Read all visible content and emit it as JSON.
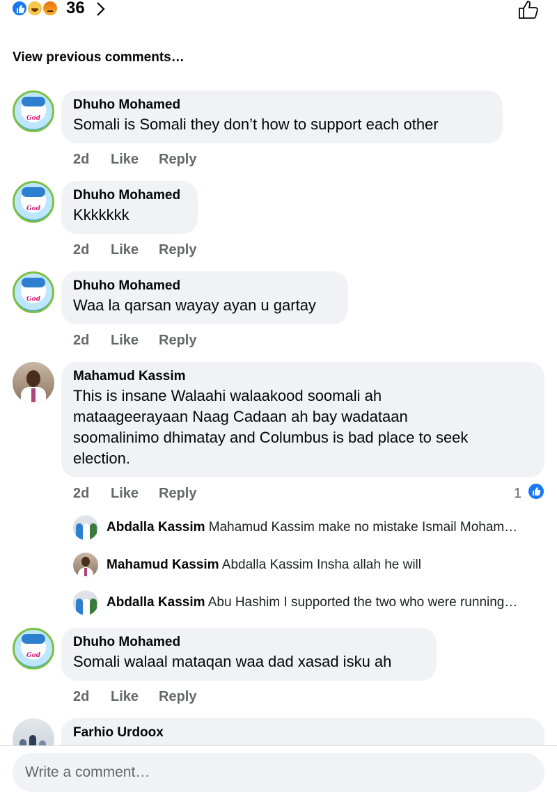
{
  "reactions": {
    "types": [
      "like-icon",
      "haha-icon",
      "angry-icon"
    ],
    "count": "36"
  },
  "view_previous": "View previous comments…",
  "comments": [
    {
      "author": "Dhuho Mohamed",
      "text": "Somali is Somali   they don’t how to support  each other",
      "time": "2d",
      "like": "Like",
      "reply": "Reply"
    },
    {
      "author": "Dhuho Mohamed",
      "text": "Kkkkkkk",
      "time": "2d",
      "like": "Like",
      "reply": "Reply"
    },
    {
      "author": "Dhuho Mohamed",
      "text": "Waa la qarsan wayay ayan u gartay",
      "time": "2d",
      "like": "Like",
      "reply": "Reply"
    },
    {
      "author": "Mahamud Kassim",
      "text_lines": [
        "This is insane Walaahi walaakood soomali ah",
        "mataageerayaan Naag Cadaan ah bay wadataan",
        "soomalinimo dhimatay and Columbus is bad place to seek",
        "election."
      ],
      "time": "2d",
      "like": "Like",
      "reply": "Reply",
      "reaction_count": "1",
      "replies": [
        {
          "author": "Abdalla Kassim",
          "text": "Mahamud Kassim make no mistake Ismail Moham…"
        },
        {
          "author": "Mahamud Kassim",
          "text": "Abdalla Kassim  Insha allah he will"
        },
        {
          "author": "Abdalla Kassim",
          "text": "Abu Hashim I supported the two who were running…"
        }
      ]
    },
    {
      "author": "Dhuho Mohamed",
      "text": "Somali walaal mataqan waa dad xasad isku ah",
      "time": "2d",
      "like": "Like",
      "reply": "Reply"
    },
    {
      "author": "Farhio Urdoox"
    }
  ],
  "avatar_text": "God",
  "composer": {
    "placeholder": "Write a comment…"
  },
  "colors": {
    "accent": "#1877f2",
    "bubble": "#f0f2f5",
    "meta": "#65676b"
  }
}
